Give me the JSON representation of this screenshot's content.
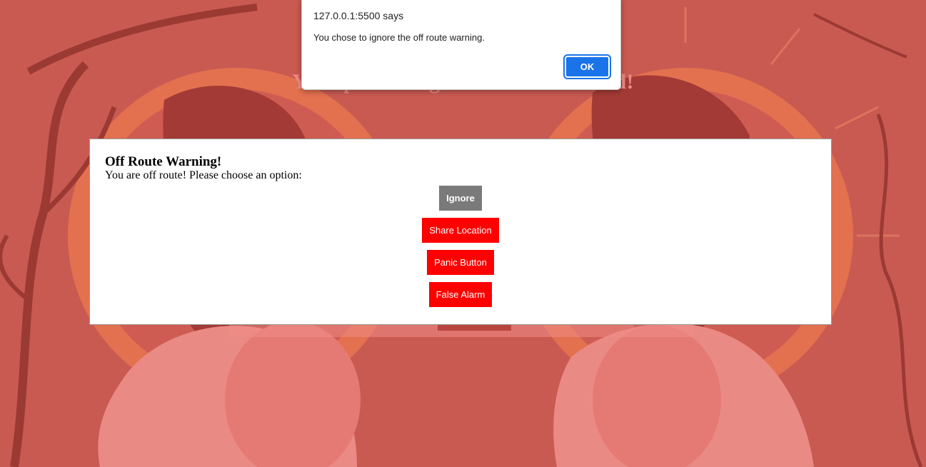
{
  "alert_dialog": {
    "origin": "127.0.0.1:5500 says",
    "message": "You chose to ignore the off route warning.",
    "ok_label": "OK"
  },
  "page": {
    "headline": "Your personal guardian on the road!"
  },
  "modal": {
    "title": "Off Route Warning!",
    "message": "You are off route! Please choose an option:",
    "actions": {
      "ignore": "Ignore",
      "share_location": "Share Location",
      "panic_button": "Panic Button",
      "false_alarm": "False Alarm"
    }
  },
  "colors": {
    "background": "#c95a52",
    "ignore_button": "#7a7a7a",
    "danger_button": "#ff0000",
    "ok_button": "#1a73e8"
  }
}
